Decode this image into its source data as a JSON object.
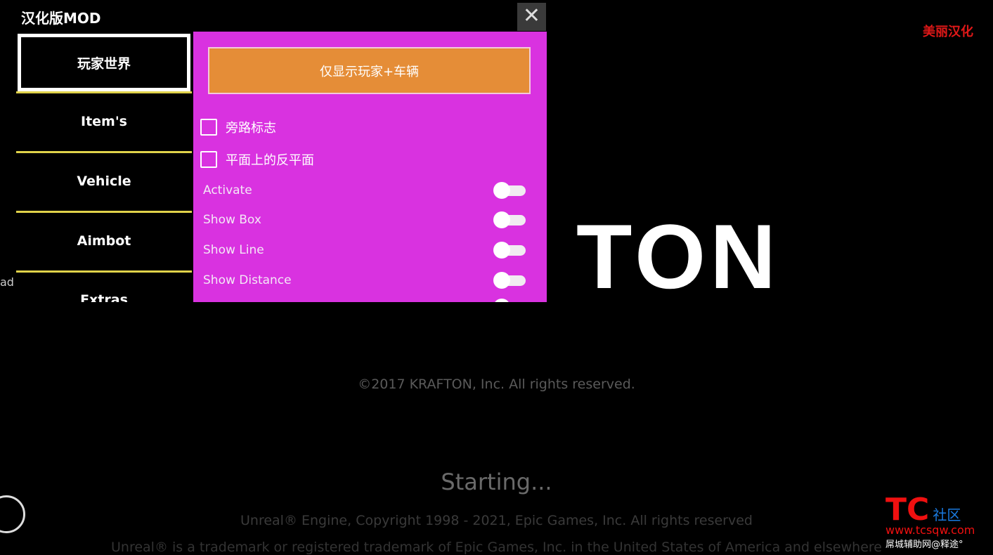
{
  "window": {
    "title": "汉化版MOD",
    "close_icon": "close-icon"
  },
  "sidebar": {
    "items": [
      {
        "label": "玩家世界",
        "active": true
      },
      {
        "label": "Item's"
      },
      {
        "label": "Vehicle"
      },
      {
        "label": "Aimbot"
      },
      {
        "label": "Extras"
      }
    ]
  },
  "panel": {
    "main_button": "仅显示玩家+车辆",
    "checkboxes": [
      {
        "label": "旁路标志",
        "checked": false
      },
      {
        "label": "平面上的反平面",
        "checked": false
      }
    ],
    "toggles": [
      {
        "label": "Activate",
        "on": false
      },
      {
        "label": "Show Box",
        "on": false
      },
      {
        "label": "Show Line",
        "on": false
      },
      {
        "label": "Show Distance",
        "on": false
      }
    ]
  },
  "background": {
    "brand_tag": "美丽汉化",
    "logo_partial": "TON",
    "side_text": "ad",
    "copyright": "©2017 KRAFTON, Inc. All rights reserved.",
    "status": "Starting...",
    "engine_copyright": "Unreal® Engine, Copyright 1998 - 2021, Epic Games, Inc. All rights reserved",
    "trademark": "Unreal® is a trademark or registered trademark of Epic Games, Inc. in the United States of America and elsewhere",
    "watermark": {
      "brand": "TC",
      "suffix": "社区",
      "url": "www.tcsqw.com",
      "caption": "屌城辅助网@释途°"
    }
  },
  "colors": {
    "panel": "#d932e0",
    "button": "#e58d37",
    "tab_border": "#e0d24a",
    "brand": "#e01818"
  }
}
